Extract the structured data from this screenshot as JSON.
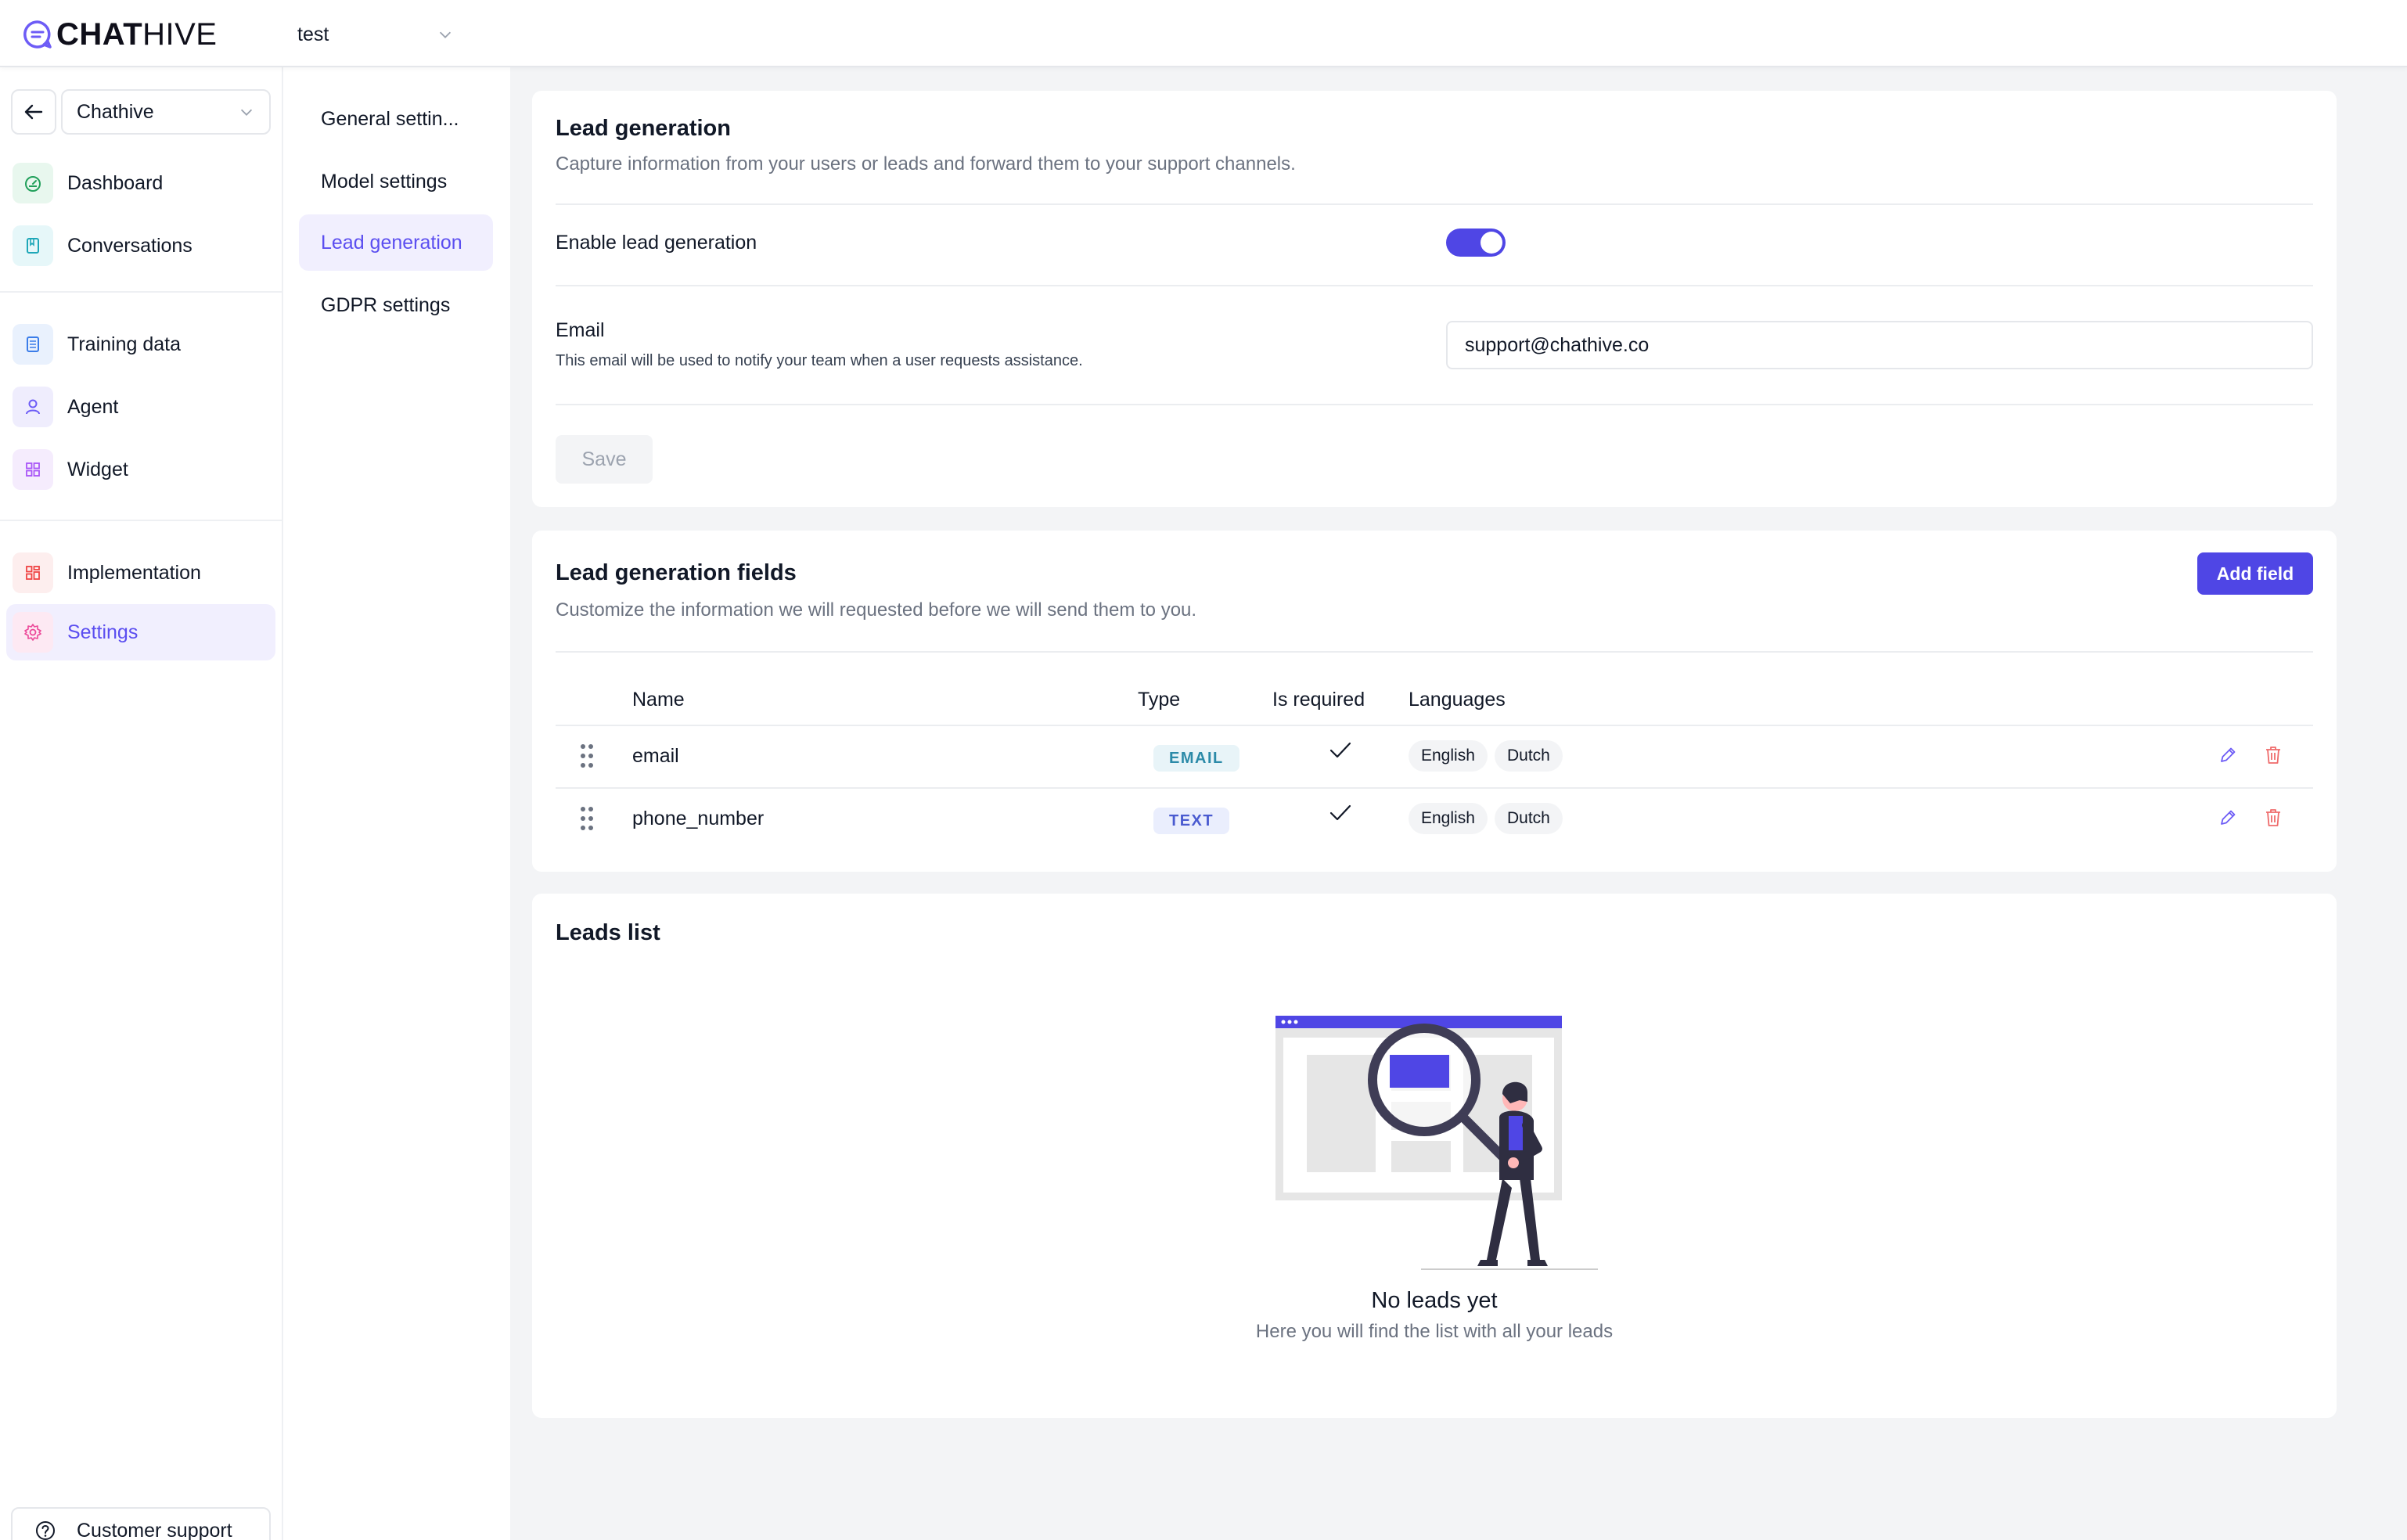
{
  "app": {
    "logo_bold": "CHAT",
    "logo_light": "HIVE",
    "project": "test"
  },
  "sidebar": {
    "bot_name": "Chathive",
    "items": [
      {
        "label": "Dashboard",
        "icon": "dashboard-icon"
      },
      {
        "label": "Conversations",
        "icon": "conversations-icon"
      },
      {
        "label": "Training data",
        "icon": "training-data-icon"
      },
      {
        "label": "Agent",
        "icon": "agent-icon"
      },
      {
        "label": "Widget",
        "icon": "widget-icon"
      },
      {
        "label": "Implementation",
        "icon": "implementation-icon"
      },
      {
        "label": "Settings",
        "icon": "settings-icon",
        "active": true
      }
    ],
    "support_label": "Customer support"
  },
  "subnav": {
    "items": [
      {
        "label": "General settin..."
      },
      {
        "label": "Model settings"
      },
      {
        "label": "Lead generation",
        "active": true
      },
      {
        "label": "GDPR settings"
      }
    ]
  },
  "lead_generation": {
    "title": "Lead generation",
    "subtitle": "Capture information from your users or leads and forward them to your support channels.",
    "enable_label": "Enable lead generation",
    "enabled": true,
    "email_label": "Email",
    "email_help": "This email will be used to notify your team when a user requests assistance.",
    "email_value": "support@chathive.co",
    "save_label": "Save"
  },
  "fields": {
    "title": "Lead generation fields",
    "subtitle": "Customize the information we will requested before we will send them to you.",
    "add_label": "Add field",
    "columns": [
      "Name",
      "Type",
      "Is required",
      "Languages"
    ],
    "rows": [
      {
        "name": "email",
        "type": "EMAIL",
        "required": true,
        "languages": [
          "English",
          "Dutch"
        ]
      },
      {
        "name": "phone_number",
        "type": "TEXT",
        "required": true,
        "languages": [
          "English",
          "Dutch"
        ]
      }
    ]
  },
  "leads": {
    "title": "Leads list",
    "empty_title": "No leads yet",
    "empty_sub": "Here you will find the list with all your leads"
  },
  "colors": {
    "accent": "#4f46e5",
    "active_bg": "#f1effe",
    "danger": "#ef6b6b"
  }
}
